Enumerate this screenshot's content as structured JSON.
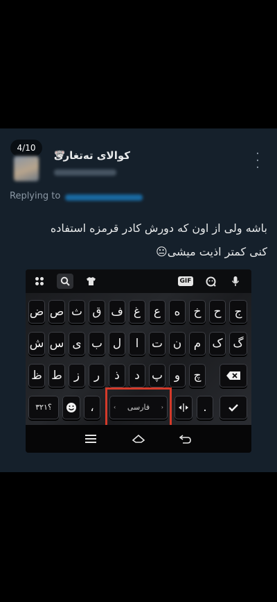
{
  "tweet": {
    "counter": "4/10",
    "author_name": "کوالای ته‌تغاری",
    "author_emoji": "🐨",
    "more_icon": "more-vertical-icon",
    "replying_label": "Replying to",
    "text_line1": "باشه ولی از اون که دورش کادر قرمزه استفاده",
    "text_line2": "کنی کمتر اذیت میشی😐"
  },
  "keyboard": {
    "toolbar": {
      "apps_icon": "apps-grid-icon",
      "search_icon": "search-icon",
      "theme_icon": "shirt-icon",
      "gif_label": "GIF",
      "sticker_icon": "sticker-icon",
      "mic_icon": "microphone-icon"
    },
    "rows": [
      [
        "ض",
        "ص",
        "ث",
        "ق",
        "ف",
        "غ",
        "ع",
        "ه",
        "خ",
        "ح",
        "ج"
      ],
      [
        "ش",
        "س",
        "ی",
        "ب",
        "ل",
        "ا",
        "ت",
        "ن",
        "م",
        "ک",
        "گ"
      ],
      [
        "ظ",
        "ط",
        "ز",
        "ر",
        "ذ",
        "د",
        "پ",
        "و",
        "چ"
      ]
    ],
    "backspace_icon": "backspace-icon",
    "bottom_row": {
      "symbols_label": "؟۳۲۱",
      "emoji_icon": "emoji-icon",
      "comma_label": "،",
      "space_label": "فارسی",
      "arrow_left": "‹",
      "arrow_right": "›",
      "cursor_icon": "cursor-move-icon",
      "period_label": ".",
      "enter_icon": "checkmark-icon"
    },
    "nav": {
      "menu_icon": "menu-icon",
      "home_icon": "home-icon",
      "back_icon": "back-icon"
    }
  }
}
